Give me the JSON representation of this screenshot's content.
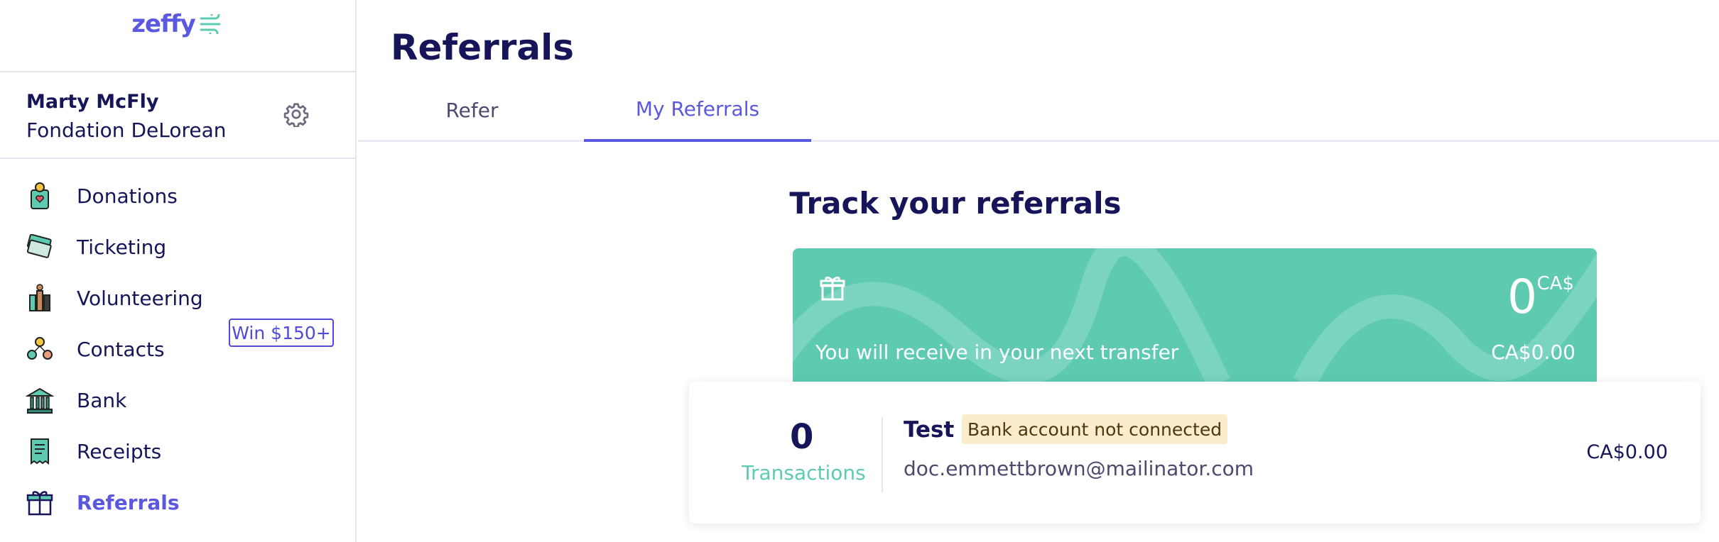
{
  "brand": {
    "name": "zeffy"
  },
  "user": {
    "name": "Marty McFly",
    "organization": "Fondation DeLorean"
  },
  "nav": {
    "items": [
      {
        "label": "Donations",
        "icon": "donation-box-icon"
      },
      {
        "label": "Ticketing",
        "icon": "tickets-icon"
      },
      {
        "label": "Volunteering",
        "icon": "volunteers-icon"
      },
      {
        "label": "Contacts",
        "icon": "contacts-icon"
      },
      {
        "label": "Bank",
        "icon": "bank-icon"
      },
      {
        "label": "Receipts",
        "icon": "receipt-icon"
      },
      {
        "label": "Referrals",
        "icon": "gift-icon",
        "active": true
      }
    ],
    "referral_badge": "Win $150+"
  },
  "page": {
    "title": "Referrals",
    "tabs": [
      {
        "label": "Refer"
      },
      {
        "label": "My Referrals",
        "active": true
      }
    ]
  },
  "summary": {
    "heading": "Track your referrals",
    "amount": "0",
    "currency": "CA$",
    "next_transfer_text": "You will receive in your next transfer",
    "next_transfer_amount": "CA$0.00"
  },
  "referrals": [
    {
      "transactions_count": "0",
      "transactions_label": "Transactions",
      "name": "Test",
      "status": "Bank account not connected",
      "email": "doc.emmettbrown@mailinator.com",
      "amount": "CA$0.00"
    }
  ],
  "colors": {
    "brand": "#5b58e0",
    "teal": "#5ecbb1",
    "navy": "#16155a",
    "warning_bg": "#fbeccb"
  }
}
